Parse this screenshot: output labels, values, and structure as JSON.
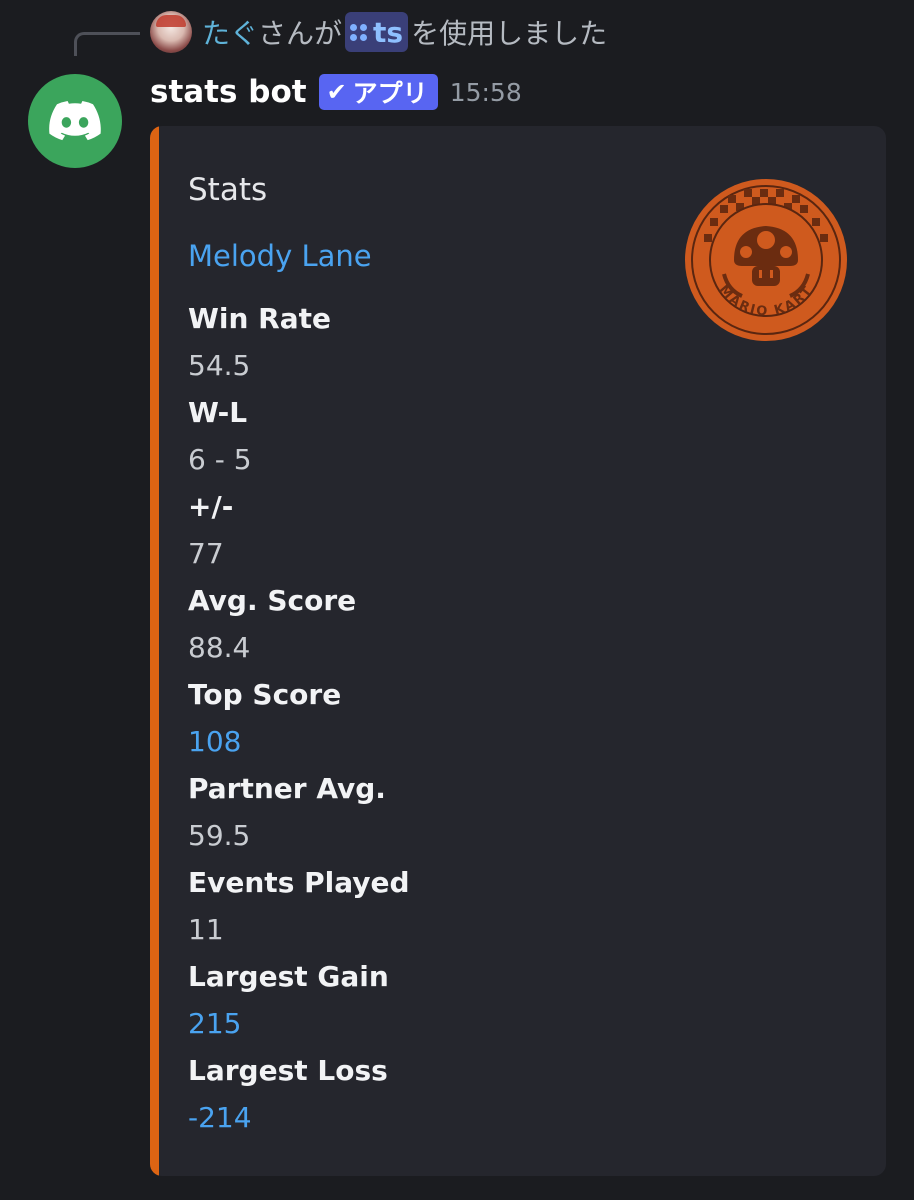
{
  "interaction": {
    "username": "たぐ",
    "text_before": "さんが",
    "command": "ts",
    "text_after": "を使用しました"
  },
  "message": {
    "author": "stats bot",
    "badge": "アプリ",
    "timestamp": "15:58"
  },
  "embed": {
    "accent_color": "#dd6413",
    "title": "Stats",
    "description": "Melody Lane",
    "thumbnail_text": "MARIO KART",
    "fields": [
      {
        "name": "Win Rate",
        "value": "54.5",
        "link": false
      },
      {
        "name": "W-L",
        "value": "6 - 5",
        "link": false
      },
      {
        "name": "+/-",
        "value": "77",
        "link": false
      },
      {
        "name": "Avg. Score",
        "value": "88.4",
        "link": false
      },
      {
        "name": "Top Score",
        "value": "108",
        "link": true
      },
      {
        "name": "Partner Avg.",
        "value": "59.5",
        "link": false
      },
      {
        "name": "Events Played",
        "value": "11",
        "link": false
      },
      {
        "name": "Largest Gain",
        "value": "215",
        "link": true
      },
      {
        "name": "Largest Loss",
        "value": "-214",
        "link": true
      }
    ]
  }
}
